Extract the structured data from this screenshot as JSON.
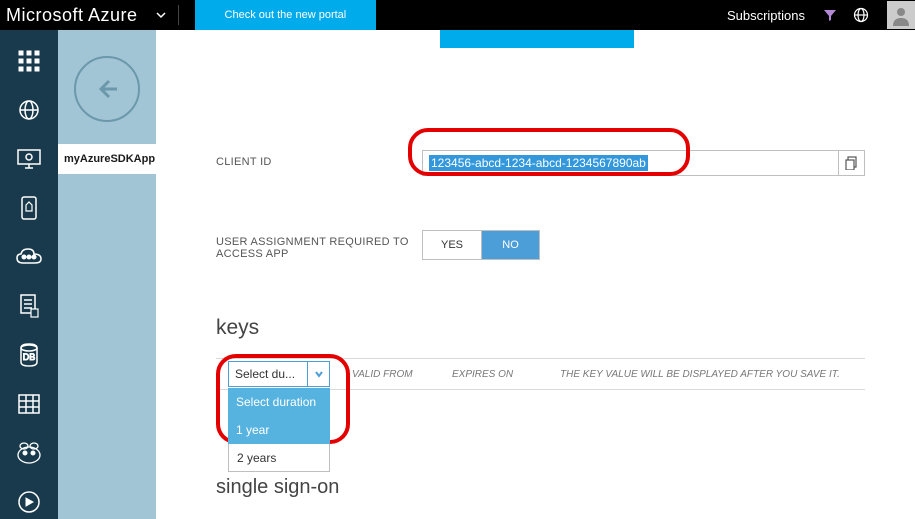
{
  "topbar": {
    "brand": "Microsoft Azure",
    "portal_button": "Check out the new portal",
    "subscriptions": "Subscriptions"
  },
  "subnav": {
    "app_name": "myAzureSDKApp"
  },
  "form": {
    "client_id": {
      "label": "CLIENT ID",
      "value": "123456-abcd-1234-abcd-1234567890ab"
    },
    "user_assignment": {
      "label": "USER ASSIGNMENT REQUIRED TO ACCESS APP",
      "yes": "YES",
      "no": "NO",
      "selected": "NO"
    },
    "keys": {
      "title": "keys",
      "duration_selected": "Select du...",
      "columns": {
        "valid_from": "VALID FROM",
        "expires_on": "EXPIRES ON",
        "value_hint": "THE KEY VALUE WILL BE DISPLAYED AFTER YOU SAVE IT."
      },
      "duration_options": [
        "Select duration",
        "1 year",
        "2 years"
      ]
    },
    "sso": {
      "title": "single sign-on"
    }
  }
}
